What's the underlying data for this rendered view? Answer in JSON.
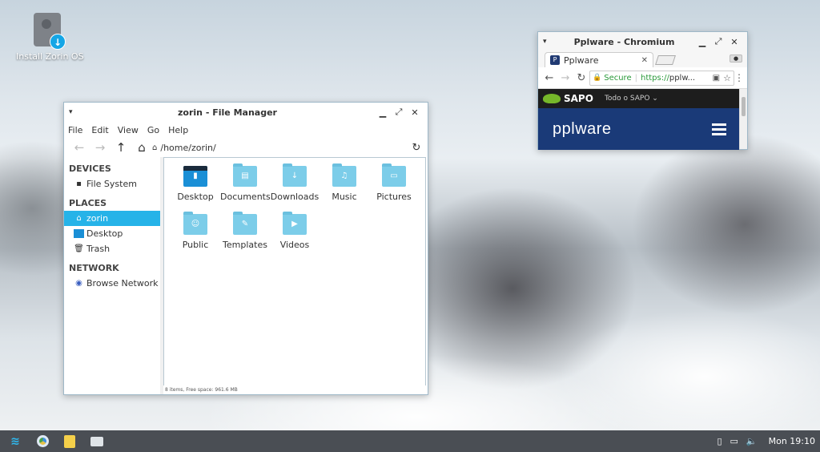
{
  "desktop": {
    "install_label": "Install Zorin OS"
  },
  "file_manager": {
    "title": "zorin - File Manager",
    "menu": [
      "File",
      "Edit",
      "View",
      "Go",
      "Help"
    ],
    "path": "/home/zorin/",
    "sidebar": {
      "devices_heading": "DEVICES",
      "devices": [
        "File System"
      ],
      "places_heading": "PLACES",
      "places": [
        "zorin",
        "Desktop",
        "Trash"
      ],
      "network_heading": "NETWORK",
      "network": [
        "Browse Network"
      ]
    },
    "files": [
      {
        "name": "Desktop",
        "icon": "desktop-folder-icon"
      },
      {
        "name": "Documents",
        "icon": "documents-folder-icon"
      },
      {
        "name": "Downloads",
        "icon": "downloads-folder-icon"
      },
      {
        "name": "Music",
        "icon": "music-folder-icon"
      },
      {
        "name": "Pictures",
        "icon": "pictures-folder-icon"
      },
      {
        "name": "Public",
        "icon": "public-folder-icon"
      },
      {
        "name": "Templates",
        "icon": "templates-folder-icon"
      },
      {
        "name": "Videos",
        "icon": "videos-folder-icon"
      }
    ],
    "status": "8 items, Free space: 961.6 MB"
  },
  "browser": {
    "title": "Pplware - Chromium",
    "tab_title": "Pplware",
    "secure_label": "Secure",
    "url_protocol": "https://",
    "url_host": "pplw...",
    "sapo_label": "SAPO",
    "sapo_menu": "Todo o SAPO",
    "site_logo": "pplware"
  },
  "taskbar": {
    "clock": "Mon 19:10"
  }
}
